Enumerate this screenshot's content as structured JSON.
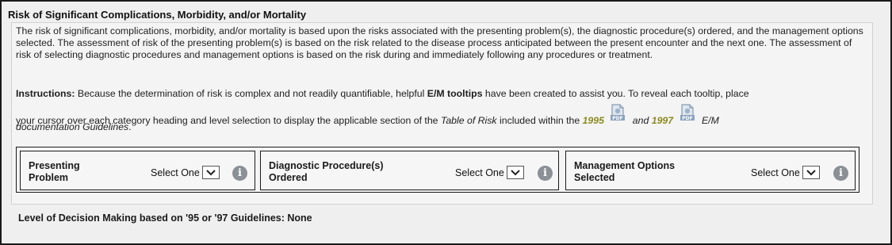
{
  "section": {
    "title": "Risk of Significant Complications, Morbidity, and/or Mortality",
    "description": "The risk of significant complications, morbidity, and/or mortality is based upon the risks associated with the presenting problem(s), the diagnostic procedure(s) ordered, and the management options selected. The assessment of risk of the presenting problem(s) is based on the risk related to the disease process anticipated between the present encounter and the next one. The assessment of risk of selecting diagnostic procedures and management options is based on the risk during and immediately following any procedures or treatment."
  },
  "instructions": {
    "label": "Instructions:",
    "text1": " Because the determination of risk is complex and not readily quantifiable, helpful ",
    "tooltips_bold": "E/M tooltips",
    "text2": " have been created to assist you. To reveal each tooltip, place",
    "line2_text": "your cursor over each category heading and level selection to display the applicable section of the ",
    "table_name": "Table of Risk",
    "line2_text2": " included within the ",
    "year_1995": "1995",
    "and_text": "and",
    "year_1997": "1997",
    "em_text": "E/M",
    "line3_text": "documentation Guidelines",
    "line3_end": "."
  },
  "risk_categories": [
    {
      "label_line1": "Presenting",
      "label_line2": "Problem",
      "select_value": "Select One"
    },
    {
      "label_line1": "Diagnostic Procedure(s)",
      "label_line2": "Ordered",
      "select_value": "Select One"
    },
    {
      "label_line1": "Management Options",
      "label_line2": "Selected",
      "select_value": "Select One"
    }
  ],
  "decision": {
    "text": "Level of Decision Making based on '95 or '97 Guidelines: None"
  },
  "icons": {
    "info": "info-icon",
    "pdf": "pdf-icon",
    "dropdown": "chevron-down-icon"
  },
  "colors": {
    "year_link": "#8b8a1f",
    "info_icon_bg": "#8b9096",
    "frame_border": "#1a1a1a"
  }
}
